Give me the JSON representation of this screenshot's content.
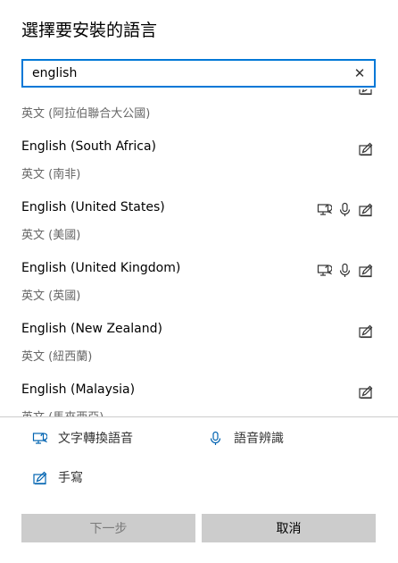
{
  "dialog": {
    "title": "選擇要安裝的語言"
  },
  "search": {
    "value": "english",
    "clear_icon": "close-icon"
  },
  "languages": [
    {
      "name": "",
      "native": "英文 (阿拉伯聯合大公國)",
      "features": [
        "handwriting-icon"
      ]
    },
    {
      "name": "English (South Africa)",
      "native": "英文 (南非)",
      "features": [
        "handwriting-icon"
      ]
    },
    {
      "name": "English (United States)",
      "native": "英文 (美國)",
      "features": [
        "text-to-speech-icon",
        "microphone-icon",
        "handwriting-icon"
      ]
    },
    {
      "name": "English (United Kingdom)",
      "native": "英文 (英國)",
      "features": [
        "text-to-speech-icon",
        "microphone-icon",
        "handwriting-icon"
      ]
    },
    {
      "name": "English (New Zealand)",
      "native": "英文 (紐西蘭)",
      "features": [
        "handwriting-icon"
      ]
    },
    {
      "name": "English (Malaysia)",
      "native": "英文 (馬來西亞)",
      "features": [
        "handwriting-icon"
      ]
    }
  ],
  "legend": {
    "text_to_speech": "文字轉換語音",
    "speech_recognition": "語音辨識",
    "handwriting": "手寫"
  },
  "buttons": {
    "next": "下一步",
    "cancel": "取消"
  },
  "colors": {
    "accent": "#0078d7",
    "icon": "#0063b1",
    "button_bg": "#cccccc",
    "secondary_text": "#666666"
  }
}
